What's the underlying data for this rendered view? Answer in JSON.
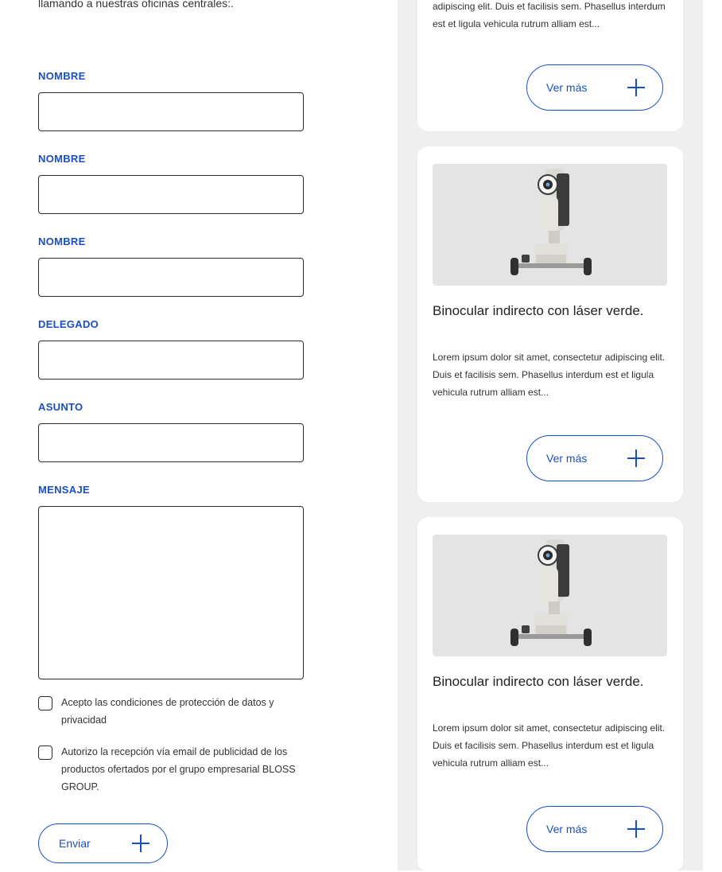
{
  "form": {
    "intro": "llamando a nuestras oficinas centrales:.",
    "fields": [
      {
        "label": "NOMBRE",
        "value": ""
      },
      {
        "label": "NOMBRE",
        "value": ""
      },
      {
        "label": "NOMBRE",
        "value": ""
      },
      {
        "label": "DELEGADO",
        "value": ""
      },
      {
        "label": "ASUNTO",
        "value": ""
      }
    ],
    "message_label": "MENSAJE",
    "message_value": "",
    "consent_privacy": "Acepto las condiciones de protección de datos y privacidad",
    "consent_marketing": "Autorizo la recepción vía email de publicidad de los productos ofertados por el grupo empresarial BLOSS GROUP.",
    "submit_label": "Enviar"
  },
  "cards": [
    {
      "title": "",
      "description": "adipiscing elit. Duis et facilisis sem. Phasellus interdum est et ligula vehicula rutrum alliam est...",
      "button_label": "Ver más"
    },
    {
      "title": "Binocular indirecto con láser verde.",
      "description": "Lorem ipsum dolor sit amet, consectetur adipiscing elit. Duis et facilisis sem. Phasellus interdum est et ligula vehicula rutrum alliam est...",
      "button_label": "Ver más"
    },
    {
      "title": "Binocular indirecto con láser verde.",
      "description": "Lorem ipsum dolor sit amet, consectetur adipiscing elit. Duis et facilisis sem. Phasellus interdum est et ligula vehicula rutrum alliam est...",
      "button_label": "Ver más"
    }
  ],
  "colors": {
    "accent": "#1a4fc4",
    "panel_bg": "#efefef",
    "card_bg": "#ffffff"
  },
  "icons": {
    "button": "plus-icon",
    "checkbox": "checkbox-empty-icon",
    "product": "ophthalmic-device-image"
  }
}
